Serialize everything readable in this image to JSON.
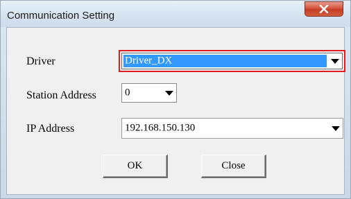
{
  "window": {
    "title": "Communication Setting",
    "close_icon": "close-x-icon"
  },
  "form": {
    "driver_label": "Driver",
    "driver_value": "Driver_DX",
    "station_label": "Station Address",
    "station_value": "0",
    "ip_label": "IP Address",
    "ip_value": "192.168.150.130"
  },
  "buttons": {
    "ok_label": "OK",
    "close_label": "Close"
  },
  "colors": {
    "highlight_border": "#e01b1b",
    "selection": "#3399ff"
  }
}
